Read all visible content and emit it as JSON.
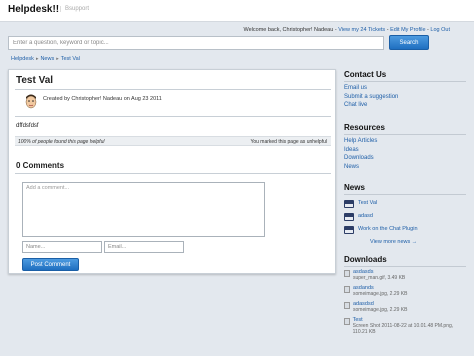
{
  "header": {
    "brand": "Helpdesk!!",
    "sub": "Bsupport"
  },
  "welcome": {
    "text": "Welcome back, Christopher! Nadeau - ",
    "view_tickets": "View my 24 Tickets",
    "edit_profile": "Edit My Profile",
    "logout": "Log Out",
    "sep": " - "
  },
  "search": {
    "placeholder": "Enter a question, keyword or topic...",
    "button": "Search"
  },
  "breadcrumb": [
    "Helpdesk",
    "News",
    "Test Val"
  ],
  "article": {
    "title": "Test Val",
    "meta": "Created by Christopher! Nadeau on Aug 23 2011",
    "body": "dffdsfdsf",
    "helpful": "100% of people found this page helpful",
    "unhelpful": "You marked this page as unhelpful"
  },
  "comments": {
    "heading": "0 Comments",
    "placeholder": "Add a comment...",
    "name_placeholder": "Name...",
    "email_placeholder": "Email...",
    "post": "Post Comment"
  },
  "sidebar": {
    "contact": {
      "title": "Contact Us",
      "links": [
        "Email us",
        "Submit a suggestion",
        "Chat live"
      ]
    },
    "resources": {
      "title": "Resources",
      "links": [
        "Help Articles",
        "Ideas",
        "Downloads",
        "News"
      ]
    },
    "news": {
      "title": "News",
      "items": [
        "Test Val",
        "adasd",
        "Work on the Chat Plugin"
      ],
      "more": "View more news →"
    },
    "downloads": {
      "title": "Downloads",
      "items": [
        {
          "name": "asdasds",
          "meta": "super_man.gif, 3.49 KB"
        },
        {
          "name": "asdands",
          "meta": "someimage.jpg, 2.29 KB"
        },
        {
          "name": "adasdsd",
          "meta": "someimage.jpg, 2.29 KB"
        },
        {
          "name": "Test",
          "meta": "Screen Shot 2011-08-22 at 10.01.48 PM.png, 110.21 KB"
        }
      ]
    }
  }
}
